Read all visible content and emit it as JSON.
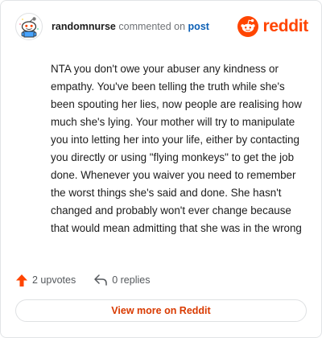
{
  "header": {
    "username": "randomnurse",
    "action": "commented on",
    "target": "post",
    "brand": "reddit",
    "avatar_icon": "snoo-avatar-icon",
    "logo_icon": "reddit-logo-icon"
  },
  "comment": {
    "body": "NTA you don't owe your abuser any kindness or empathy. You've been telling the truth while she's been spouting her lies, now people are realising how much she's lying. Your mother will try to manipulate you into letting her into your life, either by contacting you directly or using \"flying monkeys\" to get the job done. Whenever you waiver you need to remember the worst things she's said and done. She hasn't changed and probably won't ever change because that would mean admitting that she was in the wrong"
  },
  "stats": {
    "upvotes": "2 upvotes",
    "replies": "0 replies",
    "upvote_icon": "upvote-arrow-icon",
    "reply_icon": "reply-arrow-icon"
  },
  "cta": {
    "label": "View more on Reddit"
  },
  "colors": {
    "brand": "#ff4500",
    "link": "#0b5fb5",
    "cta_text": "#d93a00",
    "border": "#e2e4e6"
  }
}
